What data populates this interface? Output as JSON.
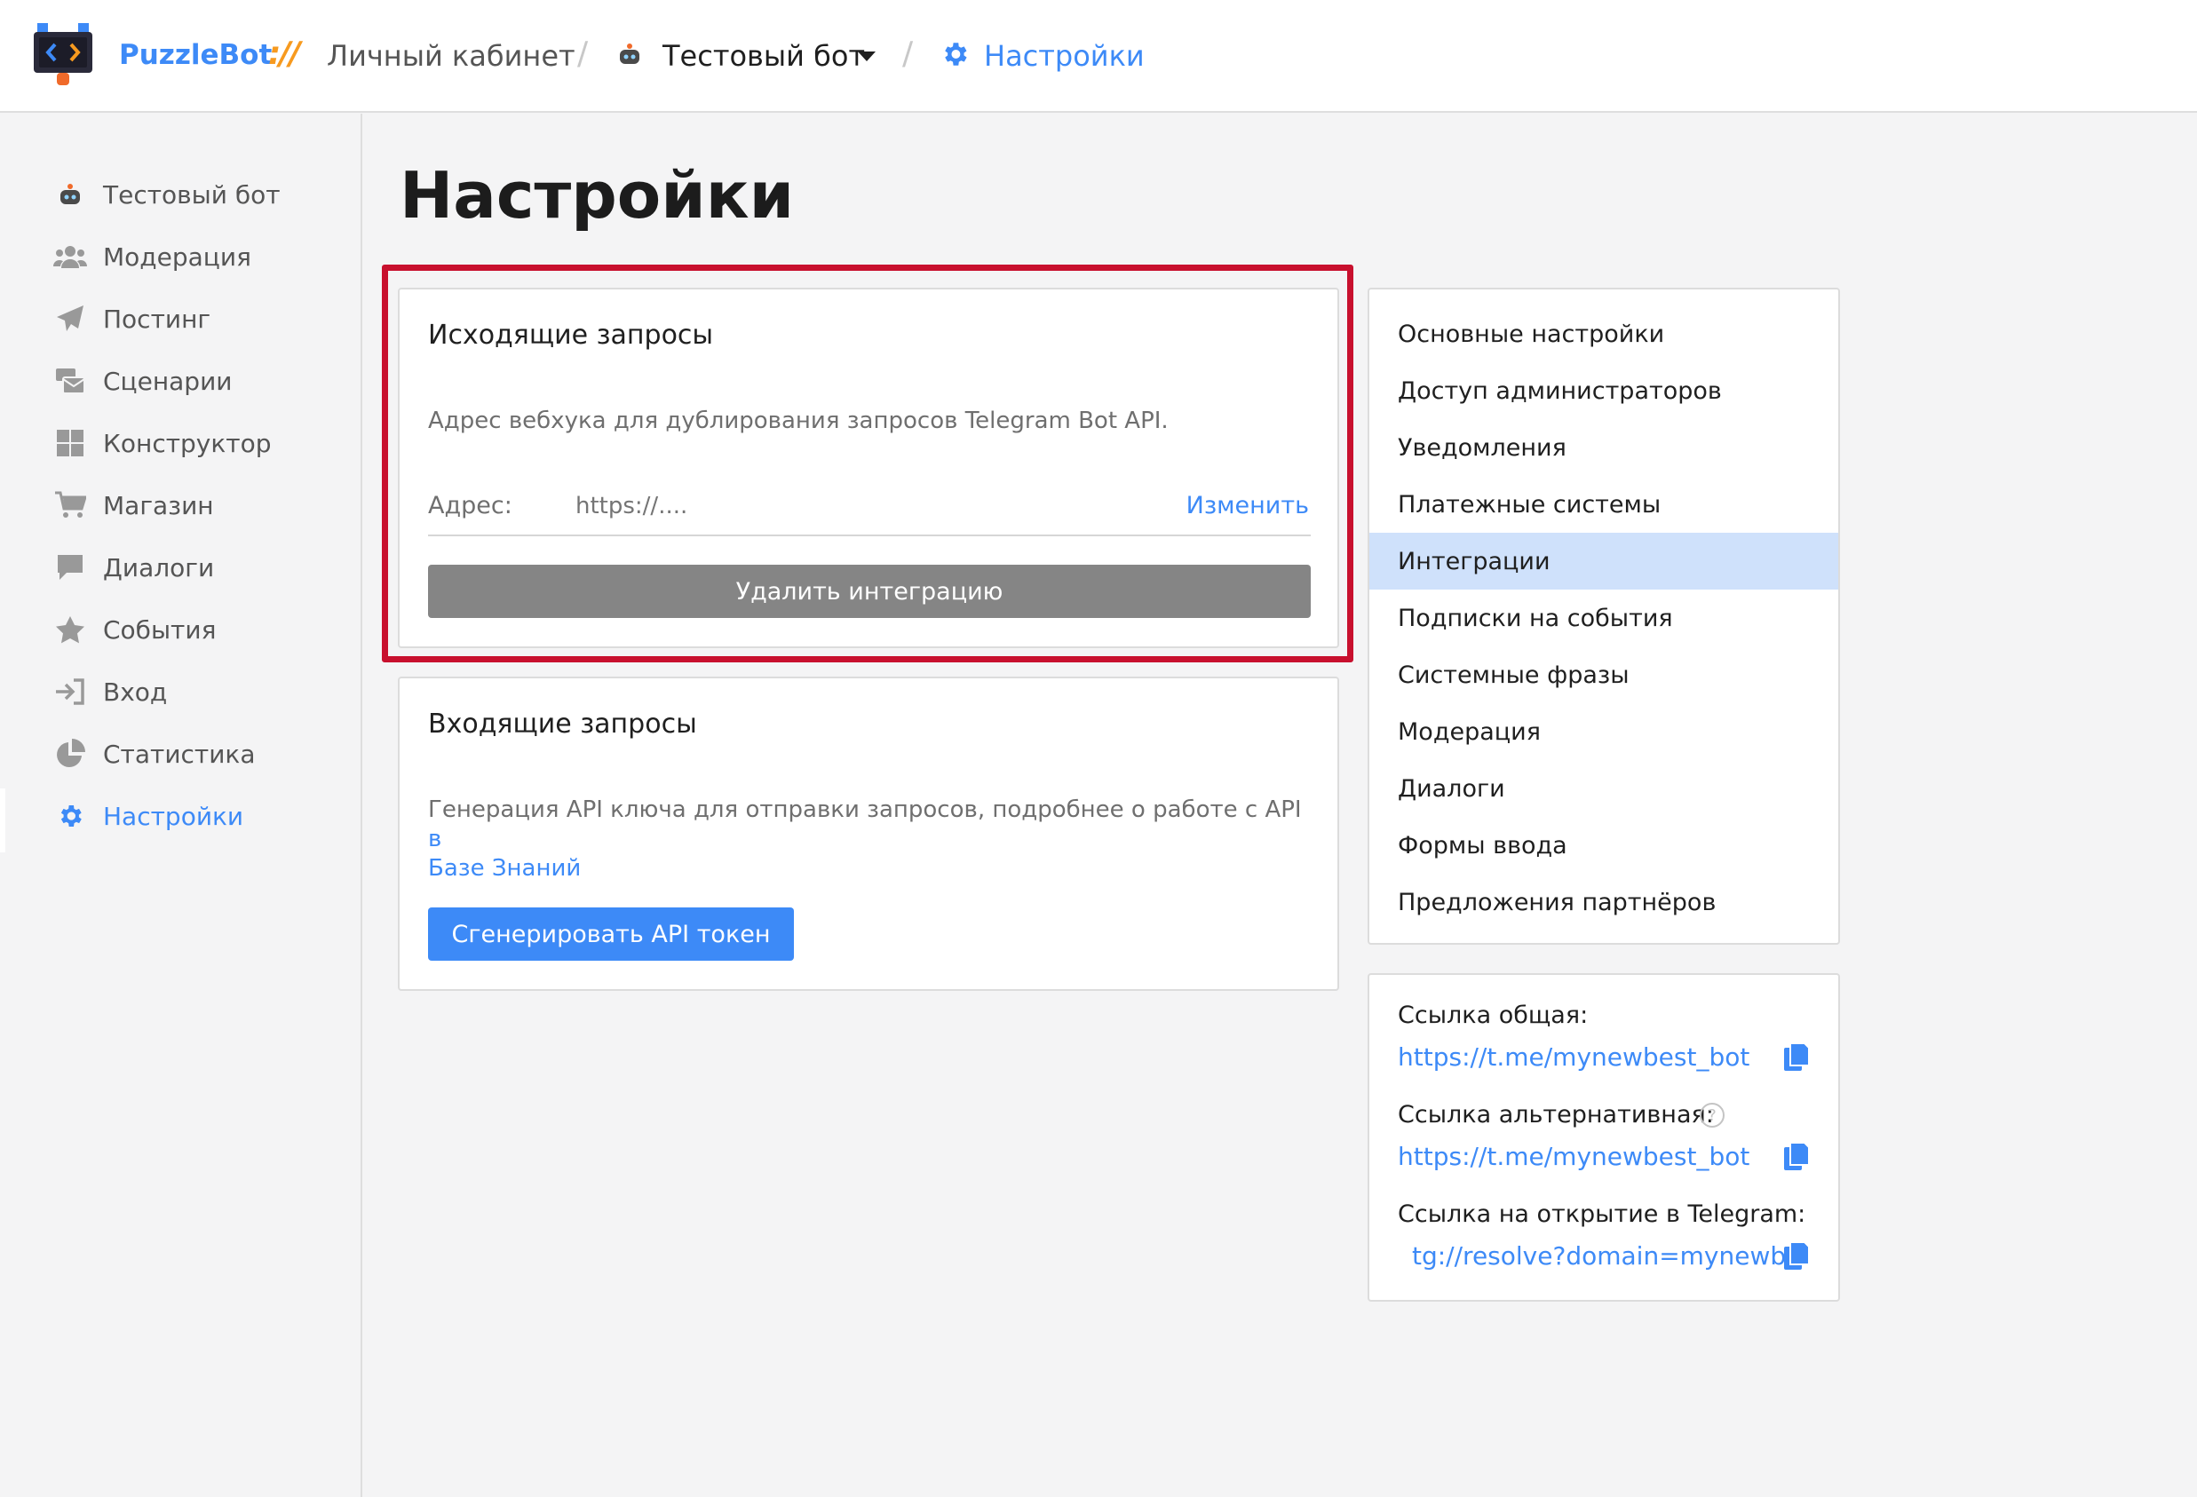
{
  "header": {
    "brand": "PuzzleBot",
    "brand_sep": "://",
    "cabinet": "Личный кабинет",
    "slash": "/",
    "bot_name": "Тестовый бот",
    "settings": "Настройки"
  },
  "sidebar": {
    "items": [
      {
        "label": "Тестовый бот",
        "icon": "robot-icon"
      },
      {
        "label": "Модерация",
        "icon": "users-icon"
      },
      {
        "label": "Постинг",
        "icon": "paper-plane-icon"
      },
      {
        "label": "Сценарии",
        "icon": "mail-bulk-icon"
      },
      {
        "label": "Конструктор",
        "icon": "grid-icon"
      },
      {
        "label": "Магазин",
        "icon": "cart-icon"
      },
      {
        "label": "Диалоги",
        "icon": "chat-icon"
      },
      {
        "label": "События",
        "icon": "star-icon"
      },
      {
        "label": "Вход",
        "icon": "sign-in-icon"
      },
      {
        "label": "Статистика",
        "icon": "pie-chart-icon"
      },
      {
        "label": "Настройки",
        "icon": "gear-icon"
      }
    ]
  },
  "main": {
    "title": "Настройки",
    "outgoing": {
      "title": "Исходящие запросы",
      "description": "Адрес вебхука для дублирования запросов Telegram Bot API.",
      "address_label": "Адрес:",
      "address_placeholder": "https://....",
      "change_label": "Изменить",
      "delete_button": "Удалить интеграцию"
    },
    "incoming": {
      "title": "Входящие запросы",
      "description_start": "Генерация API ключа для отправки запросов, подробнее о работе с API",
      "description_link_1": "в",
      "description_link_2": "Базе Знаний",
      "generate_button": "Сгенерировать API токен"
    }
  },
  "settings_menu": {
    "items": [
      "Основные настройки",
      "Доступ администраторов",
      "Уведомления",
      "Платежные системы",
      "Интеграции",
      "Подписки на события",
      "Системные фразы",
      "Модерация",
      "Диалоги",
      "Формы ввода",
      "Предложения партнёров"
    ],
    "active_item": "Интеграции"
  },
  "links": {
    "common_label": "Ссылка общая:",
    "common_url": "https://t.me/mynewbest_bot",
    "alt_label": "Ссылка альтернативная:",
    "alt_help": "?",
    "alt_url": "https://t.me/mynewbest_bot",
    "telegram_label": "Ссылка на открытие в Telegram:",
    "telegram_url": "tg://resolve?domain=mynewb..."
  },
  "colors": {
    "accent": "#3d8af7",
    "highlight_border": "#c8102e",
    "active_menu_bg": "#cfe1fb",
    "gray_button": "#858585"
  }
}
